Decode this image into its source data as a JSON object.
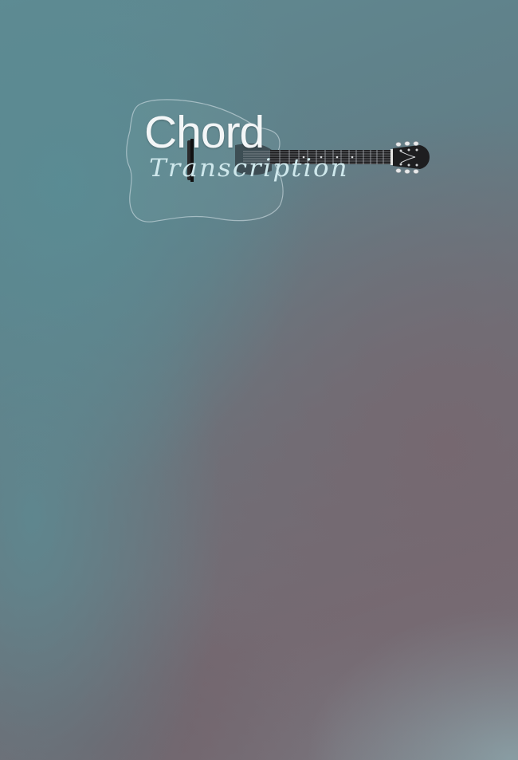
{
  "logo": {
    "title": "Chord",
    "subtitle": "Transcription",
    "icon": "acoustic-guitar"
  },
  "colors": {
    "background_teal": "#5f8a92",
    "background_mauve": "#756a72",
    "title_text": "#f3f6f7",
    "subtitle_text": "#cfe8ec"
  }
}
